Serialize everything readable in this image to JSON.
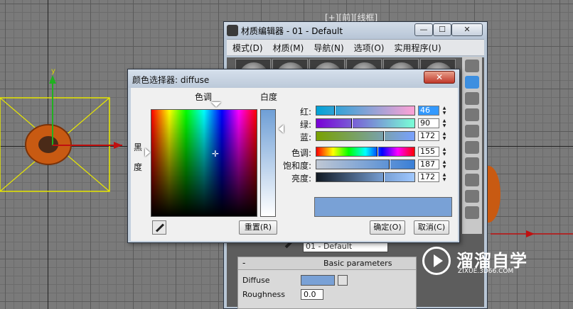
{
  "viewport": {
    "label": "[+][前][线框]"
  },
  "material_editor": {
    "title": "材质编辑器 - 01 - Default",
    "window_buttons": {
      "minimize": "—",
      "restore": "☐",
      "close": "✕"
    },
    "menu": [
      "模式(D)",
      "材质(M)",
      "导航(N)",
      "选项(O)",
      "实用程序(U)"
    ],
    "material_name": "01 - Default",
    "basic_parameters": {
      "header": "Basic parameters",
      "collapse": "-",
      "diffuse_label": "Diffuse",
      "diffuse_color": "#79a1d6",
      "roughness_label": "Roughness",
      "roughness_value": "0.0"
    },
    "side_tools": [
      "sphere-icon",
      "zoom-icon",
      "checker-icon",
      "background-icon",
      "color-icon",
      "eraser-icon",
      "assign-icon",
      "select-icon",
      "hierarchy-icon",
      "options-icon"
    ]
  },
  "color_picker": {
    "title": "颜色选择器: diffuse",
    "close_label": "✕",
    "hue_label": "色调",
    "whiteness_label": "白度",
    "blackness_label": "黑度",
    "reset_label": "重置(R)",
    "ok_label": "确定(O)",
    "cancel_label": "取消(C)",
    "current_color": "#79a1d6",
    "sliders": [
      {
        "label": "红:",
        "value": "46",
        "selected": true
      },
      {
        "label": "绿:",
        "value": "90"
      },
      {
        "label": "蓝:",
        "value": "172"
      },
      {
        "label": "色调:",
        "value": "155"
      },
      {
        "label": "饱和度:",
        "value": "187"
      },
      {
        "label": "亮度:",
        "value": "172"
      }
    ]
  },
  "watermark": {
    "text": "溜溜自学",
    "url": "ZIXUE.3D66.COM"
  }
}
